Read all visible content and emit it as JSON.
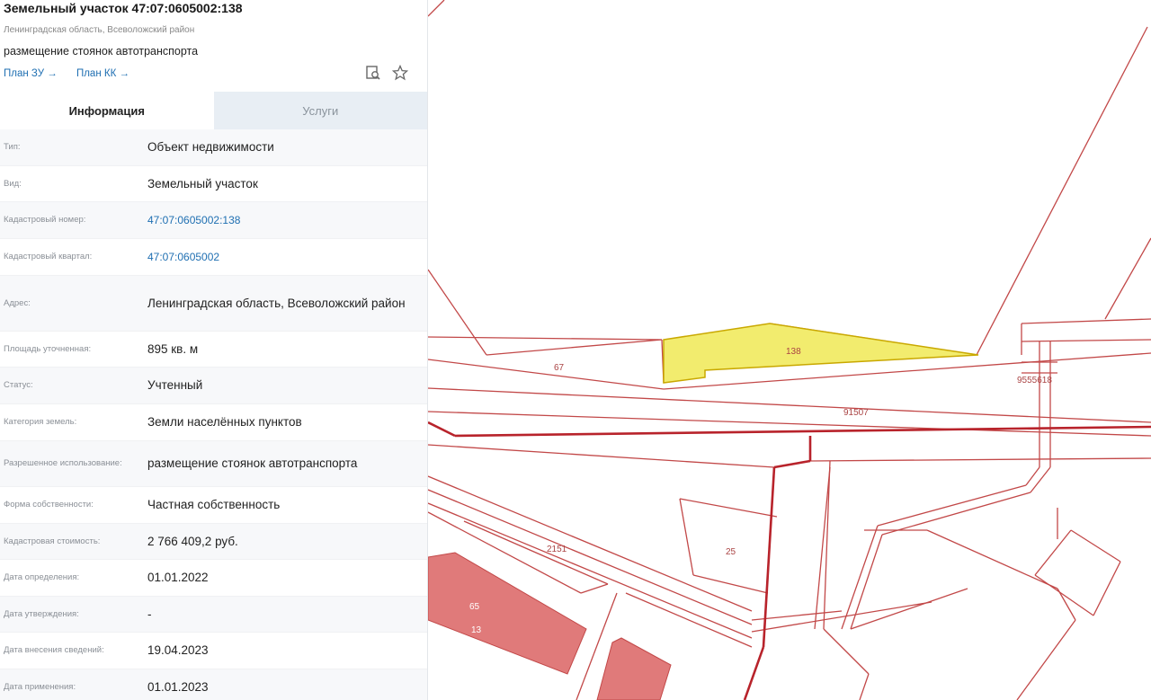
{
  "header": {
    "title": "Земельный участок 47:07:0605002:138",
    "subtitle": "Ленинградская область, Всеволожский район",
    "purpose": "размещение стоянок автотранспорта",
    "link_plan_zu": "План ЗУ →",
    "link_plan_kk": "План КК →",
    "icons": [
      "search-document-icon",
      "star-icon"
    ]
  },
  "tabs": [
    {
      "label": "Информация",
      "active": true
    },
    {
      "label": "Услуги",
      "active": false
    }
  ],
  "info_rows": [
    {
      "label": "Тип:",
      "value": "Объект недвижимости",
      "is_link": false
    },
    {
      "label": "Вид:",
      "value": "Земельный участок",
      "is_link": false
    },
    {
      "label": "Кадастровый номер:",
      "value": "47:07:0605002:138",
      "is_link": true
    },
    {
      "label": "Кадастровый квартал:",
      "value": "47:07:0605002",
      "is_link": true
    },
    {
      "label": "Адрес:",
      "value": "Ленинградская область, Всеволожский район",
      "is_link": false
    },
    {
      "label": "Площадь уточненная:",
      "value": "895 кв. м",
      "is_link": false
    },
    {
      "label": "Статус:",
      "value": "Учтенный",
      "is_link": false
    },
    {
      "label": "Категория земель:",
      "value": "Земли населённых пунктов",
      "is_link": false
    },
    {
      "label": "Разрешенное использование:",
      "value": "размещение стоянок автотранспорта",
      "is_link": false
    },
    {
      "label": "Форма собственности:",
      "value": "Частная собственность",
      "is_link": false
    },
    {
      "label": "Кадастровая стоимость:",
      "value": "2 766 409,2 руб.",
      "is_link": false
    },
    {
      "label": "Дата определения:",
      "value": "01.01.2022",
      "is_link": false
    },
    {
      "label": "Дата утверждения:",
      "value": "-",
      "is_link": false
    },
    {
      "label": "Дата внесения сведений:",
      "value": "19.04.2023",
      "is_link": false
    },
    {
      "label": "Дата применения:",
      "value": "01.01.2023",
      "is_link": false
    }
  ],
  "map": {
    "labels": {
      "p67": "67",
      "p138": "138",
      "p91507": "91507",
      "p9555618": "9555618",
      "p2151": "2151",
      "p25": "25",
      "p65": "65",
      "p13": "13"
    },
    "colors": {
      "selected_fill": "#f2ec6e",
      "selected_stroke": "#c9a800",
      "boundary": "#c24848",
      "building": "#e07a7a",
      "road_red": "#b8232b"
    }
  }
}
